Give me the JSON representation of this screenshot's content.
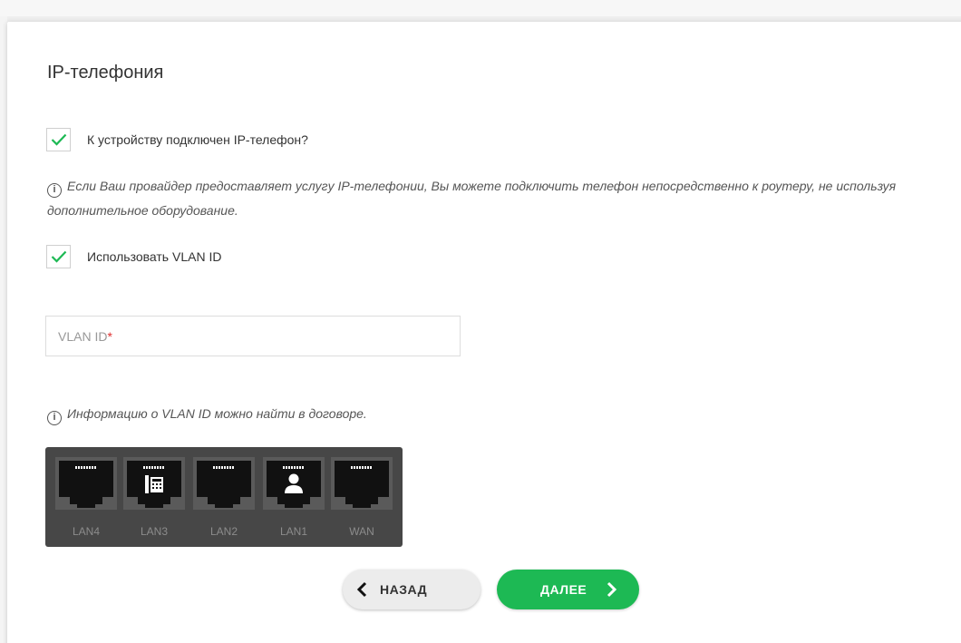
{
  "section": {
    "title": "IP-телефония"
  },
  "ip_phone_checkbox": {
    "label": "К устройству подключен IP-телефон?",
    "checked": true
  },
  "info_provider": {
    "text": "Если Ваш провайдер предоставляет услугу IP-телефонии, Вы можете подключить телефон непосредственно к роутеру, не используя дополнительное оборудование."
  },
  "vlan_checkbox": {
    "label": "Использовать VLAN ID",
    "checked": true
  },
  "vlan_input": {
    "placeholder": "VLAN ID",
    "required_mark": "*",
    "value": ""
  },
  "info_vlan": {
    "text": "Информацию о VLAN ID можно найти в договоре."
  },
  "ports": [
    {
      "label": "LAN4",
      "icon": "ethernet-port-icon"
    },
    {
      "label": "LAN3",
      "icon": "phone-port-icon"
    },
    {
      "label": "LAN2",
      "icon": "ethernet-port-icon"
    },
    {
      "label": "LAN1",
      "icon": "user-port-icon"
    },
    {
      "label": "WAN",
      "icon": "ethernet-port-icon"
    }
  ],
  "buttons": {
    "back": "НАЗАД",
    "next": "ДАЛЕЕ"
  },
  "colors": {
    "accent": "#1db954",
    "check": "#1db954",
    "required": "#e03030",
    "port_panel": "#474747"
  }
}
